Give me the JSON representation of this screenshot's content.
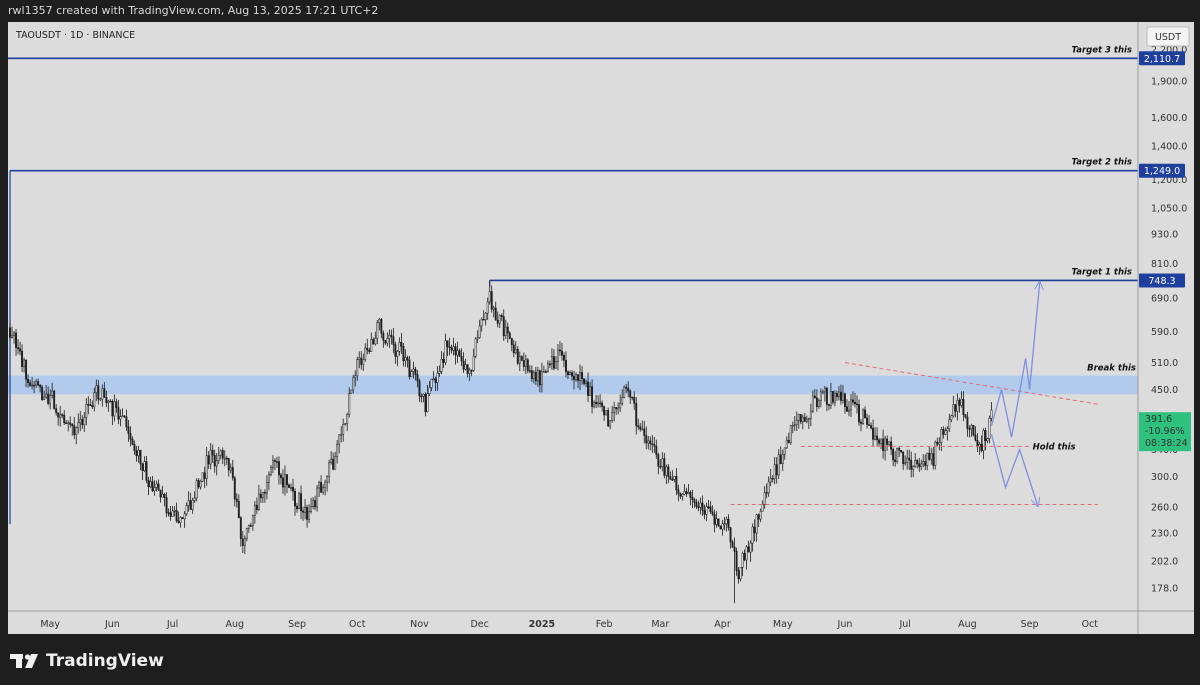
{
  "header": {
    "text": "rwl1357 created with TradingView.com, Aug 13, 2025 17:21 UTC+2"
  },
  "symbol": {
    "label": "TAOUSDT · 1D · BINANCE"
  },
  "footer": {
    "brand": "TradingView"
  },
  "price_scale": {
    "currency": "USDT"
  },
  "colors": {
    "target_line": "#1f3f9e",
    "zone": "#aac8ee",
    "dashed": "#e06a78",
    "candle_up": "#f2f2f2",
    "candle_down": "#222222",
    "last_price_badge": "#2ec27e",
    "projection": "#7d8fe0",
    "background": "#dcdcdc"
  },
  "chart_data": {
    "type": "candlestick",
    "symbol": "TAOUSDT",
    "interval": "1D",
    "exchange": "BINANCE",
    "scale": "log",
    "ylim": [
      160,
      2500
    ],
    "y_ticks": [
      "2,200.0",
      "1,900.0",
      "1,600.0",
      "1,400.0",
      "1,200.0",
      "1,050.0",
      "930.0",
      "810.0",
      "690.0",
      "590.0",
      "510.0",
      "450.0",
      "340.0",
      "300.0",
      "260.0",
      "230.0",
      "202.0",
      "178.0"
    ],
    "y_tick_values": [
      2200,
      1900,
      1600,
      1400,
      1200,
      1050,
      930,
      810,
      690,
      590,
      510,
      450,
      340,
      300,
      260,
      230,
      202,
      178
    ],
    "x_ticks": [
      "May",
      "Jun",
      "Jul",
      "Aug",
      "Sep",
      "Oct",
      "Nov",
      "Dec",
      "2025",
      "Feb",
      "Mar",
      "Apr",
      "May",
      "Jun",
      "Jul",
      "Aug",
      "Sep",
      "Oct"
    ],
    "x_range": [
      "2024-04-10",
      "2025-10-25"
    ],
    "price_path": [
      [
        "2024-04-11",
        600
      ],
      [
        "2024-04-20",
        470
      ],
      [
        "2024-05-02",
        430
      ],
      [
        "2024-05-14",
        370
      ],
      [
        "2024-05-25",
        450
      ],
      [
        "2024-06-08",
        380
      ],
      [
        "2024-06-20",
        290
      ],
      [
        "2024-07-05",
        240
      ],
      [
        "2024-07-20",
        330
      ],
      [
        "2024-07-30",
        320
      ],
      [
        "2024-08-05",
        220
      ],
      [
        "2024-08-20",
        320
      ],
      [
        "2024-09-06",
        250
      ],
      [
        "2024-09-20",
        330
      ],
      [
        "2024-10-02",
        520
      ],
      [
        "2024-10-12",
        600
      ],
      [
        "2024-10-25",
        520
      ],
      [
        "2024-11-04",
        420
      ],
      [
        "2024-11-15",
        560
      ],
      [
        "2024-11-25",
        480
      ],
      [
        "2024-12-06",
        690
      ],
      [
        "2024-12-20",
        520
      ],
      [
        "2025-01-01",
        470
      ],
      [
        "2025-01-10",
        530
      ],
      [
        "2025-01-25",
        440
      ],
      [
        "2025-02-03",
        390
      ],
      [
        "2025-02-12",
        450
      ],
      [
        "2025-02-21",
        360
      ],
      [
        "2025-03-05",
        300
      ],
      [
        "2025-03-20",
        265
      ],
      [
        "2025-04-03",
        240
      ],
      [
        "2025-04-09",
        190
      ],
      [
        "2025-04-22",
        270
      ],
      [
        "2025-05-05",
        370
      ],
      [
        "2025-05-20",
        440
      ],
      [
        "2025-06-05",
        420
      ],
      [
        "2025-06-22",
        340
      ],
      [
        "2025-07-05",
        320
      ],
      [
        "2025-07-15",
        330
      ],
      [
        "2025-07-28",
        430
      ],
      [
        "2025-08-07",
        340
      ],
      [
        "2025-08-13",
        391.6
      ]
    ],
    "wick_extremes": {
      "high": [
        "2024-12-06",
        748.3
      ],
      "low": [
        "2025-04-07",
        166
      ]
    },
    "horizontal_levels": [
      {
        "name": "Target 3 this",
        "value": 2110.7,
        "label": "2,110.7",
        "start": "2024-04-10"
      },
      {
        "name": "Target 2 this",
        "value": 1249.0,
        "label": "1,249.0",
        "start": "2024-04-11"
      },
      {
        "name": "Target 1 this",
        "value": 748.3,
        "label": "748.3",
        "start": "2024-12-06"
      }
    ],
    "zone": {
      "name": "Break this",
      "low": 440,
      "high": 480,
      "start": "2024-04-10"
    },
    "support_lines": [
      {
        "name": "Hold this",
        "value": 345,
        "start": "2025-05-10",
        "end": "2025-09-01"
      },
      {
        "value": 263,
        "start": "2025-04-05",
        "end": "2025-10-05"
      }
    ],
    "trendline": {
      "from": [
        "2025-06-01",
        510
      ],
      "to": [
        "2025-10-05",
        420
      ]
    },
    "projection_bullish": [
      [
        "2025-08-13",
        380
      ],
      [
        "2025-08-18",
        450
      ],
      [
        "2025-08-23",
        360
      ],
      [
        "2025-08-30",
        520
      ],
      [
        "2025-09-01",
        450
      ],
      [
        "2025-09-06",
        740
      ]
    ],
    "projection_bearish": [
      [
        "2025-08-13",
        365
      ],
      [
        "2025-08-20",
        285
      ],
      [
        "2025-08-27",
        340
      ],
      [
        "2025-09-05",
        262
      ]
    ],
    "last_price": {
      "price": "391.6",
      "change": "-10.96%",
      "countdown": "08:38:24"
    }
  }
}
